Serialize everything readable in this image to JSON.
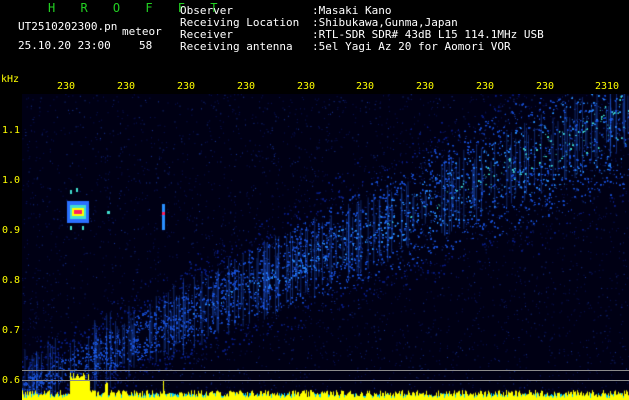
{
  "header": {
    "brand": "H R O F F T",
    "filename": "UT2510202300.pn",
    "mode": "meteor",
    "datetime": "25.10.20 23:00",
    "count": "58",
    "fields": [
      {
        "label": "Observer",
        "value": ":Masaki Kano"
      },
      {
        "label": "Receiving Location",
        "value": ":Shibukawa,Gunma,Japan"
      },
      {
        "label": "Receiver",
        "value": ":RTL-SDR SDR# 43dB L15 114.1MHz USB"
      },
      {
        "label": "Receiving antenna",
        "value": ":5el Yagi Az 20 for Aomori VOR"
      }
    ]
  },
  "axes": {
    "y_unit": "kHz",
    "y_ticks": [
      "1.1",
      "1.0",
      "0.9",
      "0.8",
      "0.7",
      "0.6"
    ],
    "x_ticks": [
      "230",
      "230",
      "230",
      "230",
      "230",
      "230",
      "230",
      "230",
      "230",
      "2310"
    ]
  },
  "colors": {
    "background": "#000000",
    "text_header": "#ffffff",
    "brand": "#22d022",
    "axis_labels": "#ffff00",
    "reference_lines": "#8b8b8b",
    "signal_bars": "#ffff00",
    "noise_floor": "#00ccff"
  }
}
